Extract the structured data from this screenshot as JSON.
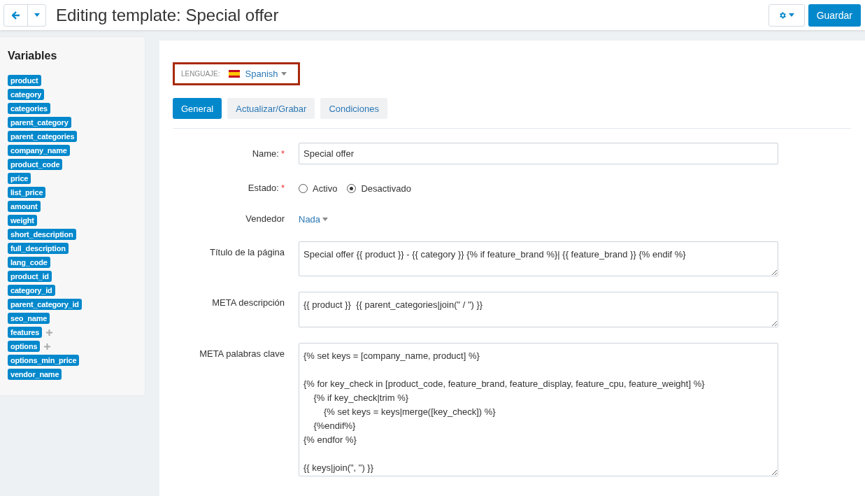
{
  "header": {
    "title": "Editing template: Special offer",
    "save_button": "Guardar"
  },
  "sidebar": {
    "title": "Variables",
    "items": [
      {
        "label": "product",
        "expandable": false
      },
      {
        "label": "category",
        "expandable": false
      },
      {
        "label": "categories",
        "expandable": false
      },
      {
        "label": "parent_category",
        "expandable": false
      },
      {
        "label": "parent_categories",
        "expandable": false
      },
      {
        "label": "company_name",
        "expandable": false
      },
      {
        "label": "product_code",
        "expandable": false
      },
      {
        "label": "price",
        "expandable": false
      },
      {
        "label": "list_price",
        "expandable": false
      },
      {
        "label": "amount",
        "expandable": false
      },
      {
        "label": "weight",
        "expandable": false
      },
      {
        "label": "short_description",
        "expandable": false
      },
      {
        "label": "full_description",
        "expandable": false
      },
      {
        "label": "lang_code",
        "expandable": false
      },
      {
        "label": "product_id",
        "expandable": false
      },
      {
        "label": "category_id",
        "expandable": false
      },
      {
        "label": "parent_category_id",
        "expandable": false
      },
      {
        "label": "seo_name",
        "expandable": false
      },
      {
        "label": "features",
        "expandable": true
      },
      {
        "label": "options",
        "expandable": true
      },
      {
        "label": "options_min_price",
        "expandable": false
      },
      {
        "label": "vendor_name",
        "expandable": false
      }
    ]
  },
  "language": {
    "label": "LENGUAJE:",
    "value": "Spanish",
    "highlighted": true
  },
  "tabs": [
    {
      "label": "General",
      "selected": true
    },
    {
      "label": "Actualizar/Grabar",
      "selected": false
    },
    {
      "label": "Condiciones",
      "selected": false
    }
  ],
  "fields": [
    {
      "kind": "text",
      "label": "Name:",
      "required_mark": "*",
      "value": "Special offer"
    },
    {
      "kind": "radio",
      "label": "Estado:",
      "required_mark": "*",
      "options": [
        {
          "label": "Activo",
          "selected": false
        },
        {
          "label": "Desactivado",
          "selected": true
        }
      ]
    },
    {
      "kind": "dropdown",
      "label": "Vendedor",
      "value": "Nada"
    },
    {
      "kind": "textarea",
      "label": "Título de la página",
      "value": "Special offer {{ product }} - {{ category }} {% if feature_brand %}| {{ feature_brand }} {% endif %}"
    },
    {
      "kind": "textarea",
      "label": "META descripción",
      "value": "{{ product }}  {{ parent_categories|join(\" / \") }}"
    },
    {
      "kind": "textarea",
      "label": "META palabras clave",
      "value": "{% set keys = [company_name, product] %}\n\n{% for key_check in [product_code, feature_brand, feature_display, feature_cpu, feature_weight] %}\n    {% if key_check|trim %}\n        {% set keys = keys|merge([key_check]) %}\n    {%endif%}\n{% endfor %}\n\n{{ keys|join(\", \") }}"
    }
  ]
}
